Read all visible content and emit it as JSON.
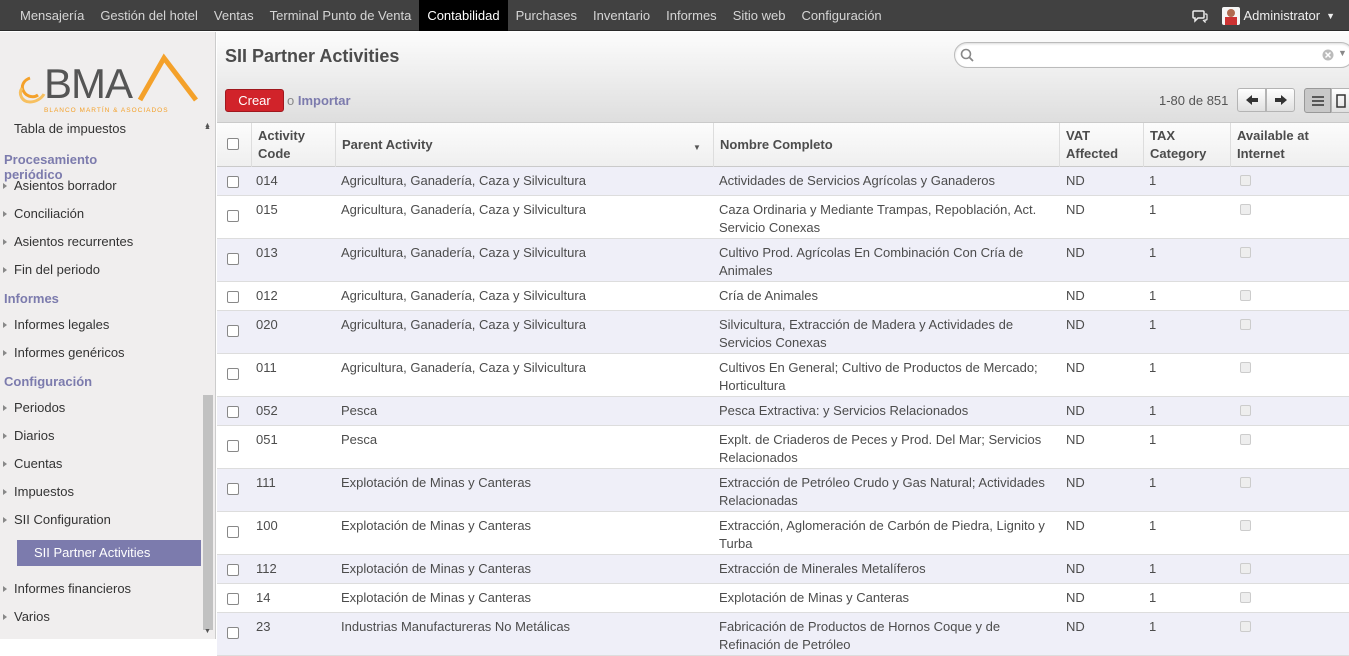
{
  "topbar": {
    "menu": [
      "Mensajería",
      "Gestión del hotel",
      "Ventas",
      "Terminal Punto de Venta",
      "Contabilidad",
      "Purchases",
      "Inventario",
      "Informes",
      "Sitio web",
      "Configuración"
    ],
    "active": "Contabilidad",
    "user": "Administrator"
  },
  "logo": {
    "text": "BMA",
    "subtitle": "BLANCO MARTÍN & ASOCIADOS"
  },
  "sidebar": {
    "top_item": "Tabla de impuestos",
    "sections": [
      {
        "title": "Procesamiento periódico",
        "items": [
          "Asientos borrador",
          "Conciliación",
          "Asientos recurrentes",
          "Fin del periodo"
        ]
      },
      {
        "title": "Informes",
        "items": [
          "Informes legales",
          "Informes genéricos"
        ]
      },
      {
        "title": "Configuración",
        "items": [
          "Periodos",
          "Diarios",
          "Cuentas",
          "Impuestos",
          "SII Configuration"
        ]
      }
    ],
    "active_item": "SII Partner Activities",
    "bottom_items": [
      "Informes financieros",
      "Varios"
    ]
  },
  "page": {
    "title": "SII Partner Activities",
    "create_label": "Crear",
    "or_label": "o",
    "import_label": "Importar",
    "pager": "1-80 de 851",
    "search_value": ""
  },
  "table": {
    "headers": [
      "Activity Code",
      "Parent Activity",
      "Nombre Completo",
      "VAT Affected",
      "TAX Category",
      "Available at Internet"
    ],
    "rows": [
      [
        "014",
        "Agricultura, Ganadería, Caza y Silvicultura",
        "Actividades de Servicios Agrícolas y Ganaderos",
        "ND",
        "1"
      ],
      [
        "015",
        "Agricultura, Ganadería, Caza y Silvicultura",
        "Caza Ordinaria y Mediante Trampas, Repoblación, Act. Servicio Conexas",
        "ND",
        "1"
      ],
      [
        "013",
        "Agricultura, Ganadería, Caza y Silvicultura",
        "Cultivo Prod. Agrícolas En Combinación Con Cría de Animales",
        "ND",
        "1"
      ],
      [
        "012",
        "Agricultura, Ganadería, Caza y Silvicultura",
        "Cría de Animales",
        "ND",
        "1"
      ],
      [
        "020",
        "Agricultura, Ganadería, Caza y Silvicultura",
        "Silvicultura, Extracción de Madera y Actividades de Servicios Conexas",
        "ND",
        "1"
      ],
      [
        "011",
        "Agricultura, Ganadería, Caza y Silvicultura",
        "Cultivos En General; Cultivo de Productos de Mercado; Horticultura",
        "ND",
        "1"
      ],
      [
        "052",
        "Pesca",
        "Pesca Extractiva: y Servicios Relacionados",
        "ND",
        "1"
      ],
      [
        "051",
        "Pesca",
        "Explt. de Criaderos de Peces y Prod. Del Mar; Servicios Relacionados",
        "ND",
        "1"
      ],
      [
        "111",
        "Explotación de Minas y Canteras",
        "Extracción de Petróleo Crudo y Gas Natural; Actividades Relacionadas",
        "ND",
        "1"
      ],
      [
        "100",
        "Explotación de Minas y Canteras",
        "Extracción, Aglomeración de Carbón de Piedra, Lignito y Turba",
        "ND",
        "1"
      ],
      [
        "112",
        "Explotación de Minas y Canteras",
        "Extracción de Minerales Metalíferos",
        "ND",
        "1"
      ],
      [
        "14",
        "Explotación de Minas y Canteras",
        "Explotación de Minas y Canteras",
        "ND",
        "1"
      ],
      [
        "23",
        "Industrias Manufactureras No Metálicas",
        "Fabricación de Productos de Hornos Coque y de Refinación de Petróleo",
        "ND",
        "1"
      ]
    ]
  }
}
